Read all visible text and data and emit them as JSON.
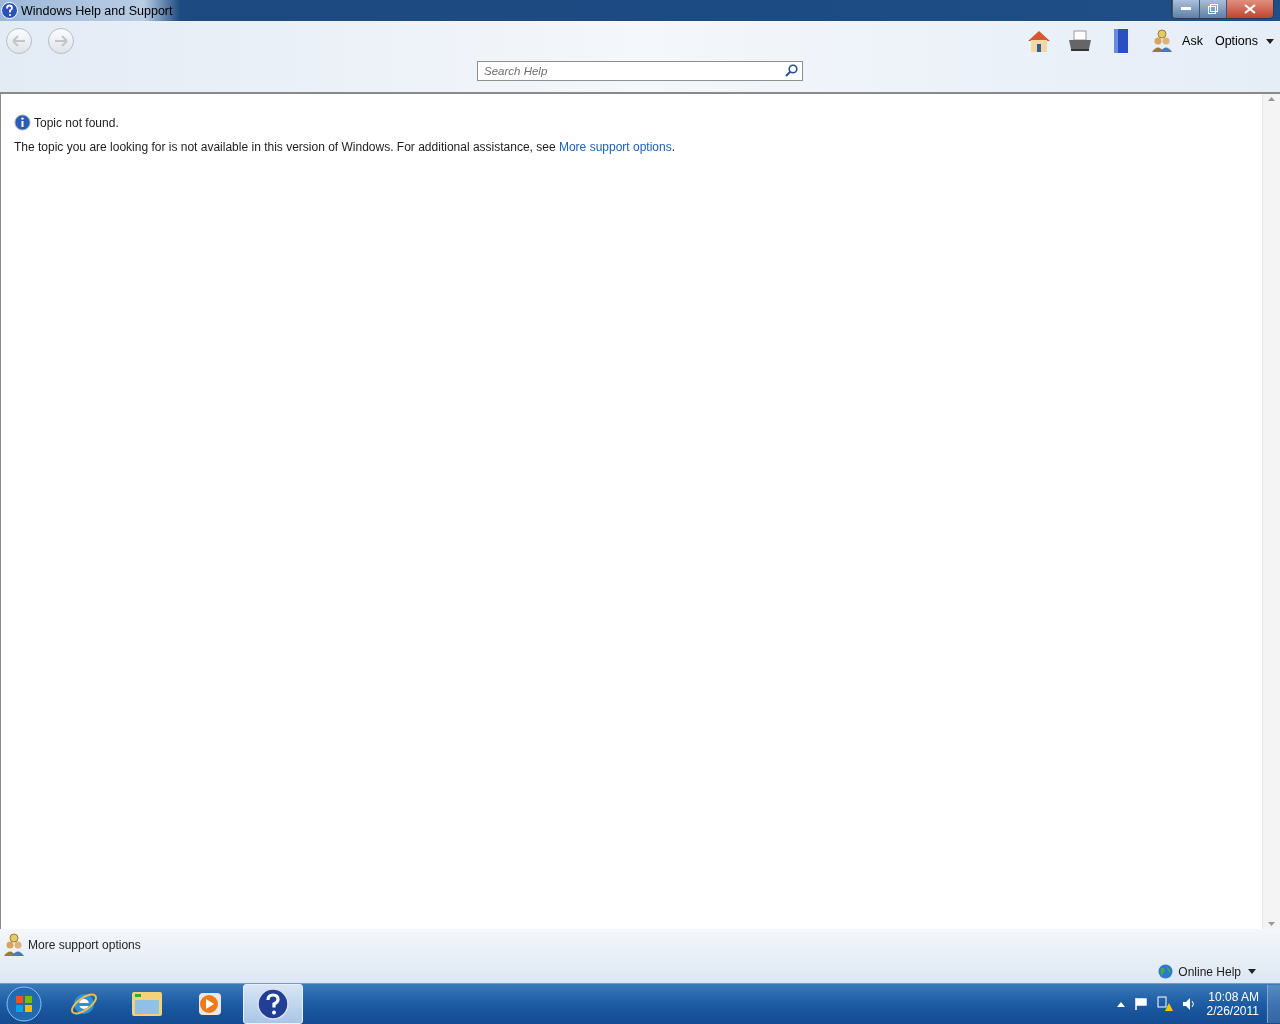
{
  "window": {
    "title": "Windows Help and Support"
  },
  "toolbar": {
    "ask_label": "Ask",
    "options_label": "Options",
    "search": {
      "placeholder": "Search Help"
    }
  },
  "content": {
    "heading": "Topic not found.",
    "message": "The topic you are looking for is not available in this version of Windows. For additional assistance, see ",
    "link": "More support options",
    "suffix": "."
  },
  "status_bar": {
    "support_link": "More support options",
    "online_help": "Online Help"
  },
  "taskbar": {
    "items": [
      {
        "kind": "ie",
        "selected": false
      },
      {
        "kind": "folder",
        "selected": false
      },
      {
        "kind": "media",
        "selected": false
      },
      {
        "kind": "help",
        "selected": true
      }
    ],
    "time": "10:08 AM",
    "date": "2/26/2011"
  }
}
